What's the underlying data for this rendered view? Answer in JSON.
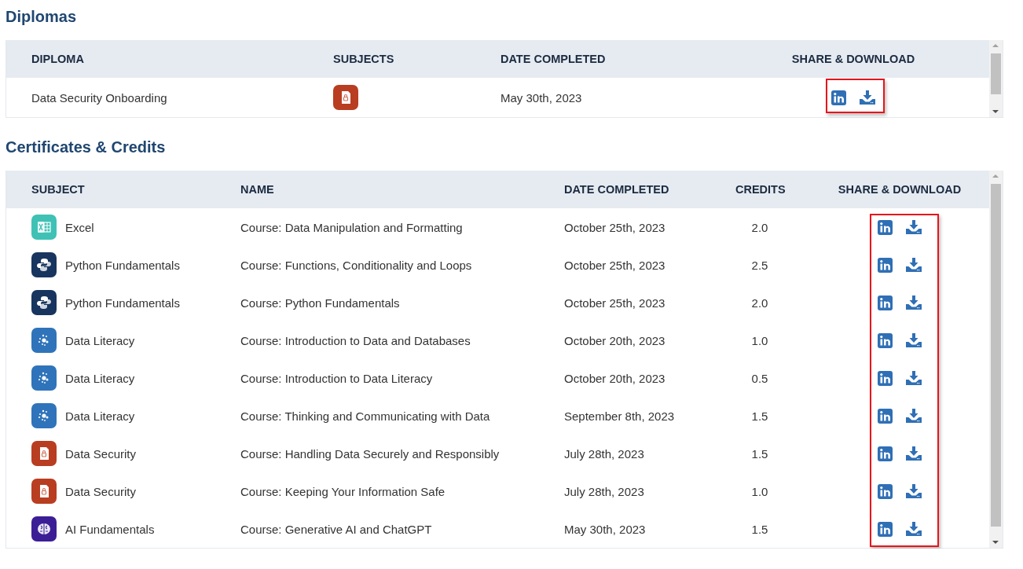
{
  "sections": [
    {
      "title": "Diplomas",
      "kind": "diplomas",
      "highlighted": true,
      "columns": [
        "DIPLOMA",
        "SUBJECTS",
        "DATE COMPLETED",
        "SHARE & DOWNLOAD"
      ],
      "rows": [
        {
          "diploma": "Data Security Onboarding",
          "kind": "security",
          "date": "May 30th, 2023"
        }
      ]
    },
    {
      "title": "Certificates & Credits",
      "kind": "certificates",
      "highlighted": true,
      "columns": [
        "SUBJECT",
        "NAME",
        "DATE COMPLETED",
        "CREDITS",
        "SHARE & DOWNLOAD"
      ],
      "rows": [
        {
          "kind": "excel",
          "subject": "Excel",
          "name": "Course: Data Manipulation and Formatting",
          "date": "October 25th, 2023",
          "credits": "2.0"
        },
        {
          "kind": "python",
          "subject": "Python Fundamentals",
          "name": "Course: Functions, Conditionality and Loops",
          "date": "October 25th, 2023",
          "credits": "2.5"
        },
        {
          "kind": "python",
          "subject": "Python Fundamentals",
          "name": "Course: Python Fundamentals",
          "date": "October 25th, 2023",
          "credits": "2.0"
        },
        {
          "kind": "data-literacy",
          "subject": "Data Literacy",
          "name": "Course: Introduction to Data and Databases",
          "date": "October 20th, 2023",
          "credits": "1.0"
        },
        {
          "kind": "data-literacy",
          "subject": "Data Literacy",
          "name": "Course: Introduction to Data Literacy",
          "date": "October 20th, 2023",
          "credits": "0.5"
        },
        {
          "kind": "data-literacy",
          "subject": "Data Literacy",
          "name": "Course: Thinking and Communicating with Data",
          "date": "September 8th, 2023",
          "credits": "1.5"
        },
        {
          "kind": "security",
          "subject": "Data Security",
          "name": "Course: Handling Data Securely and Responsibly",
          "date": "July 28th, 2023",
          "credits": "1.5"
        },
        {
          "kind": "security",
          "subject": "Data Security",
          "name": "Course: Keeping Your Information Safe",
          "date": "July 28th, 2023",
          "credits": "1.0"
        },
        {
          "kind": "ai",
          "subject": "AI Fundamentals",
          "name": "Course: Generative AI and ChatGPT",
          "date": "May 30th, 2023",
          "credits": "1.5"
        }
      ]
    }
  ]
}
